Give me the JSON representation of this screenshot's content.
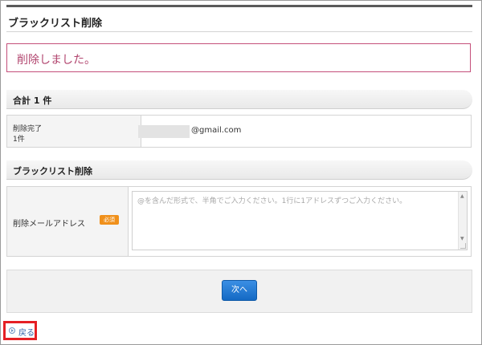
{
  "page": {
    "title": "ブラックリスト削除"
  },
  "alert": {
    "message": "削除しました。"
  },
  "summary": {
    "heading": "合計 1 件",
    "row_label_line1": "削除完了",
    "row_label_line2": "1件",
    "email_domain": "@gmail.com"
  },
  "form": {
    "heading": "ブラックリスト削除",
    "field_label": "削除メールアドレス",
    "required_badge": "必須",
    "textarea_placeholder": "@を含んだ形式で、半角でご入力ください。1行に1アドレスずつご入力ください。"
  },
  "actions": {
    "next_label": "次へ"
  },
  "footer": {
    "back_label": "戻る"
  },
  "colors": {
    "alert_border": "#c44f7a",
    "alert_text": "#b2466f",
    "primary_button": "#1469c4",
    "badge": "#f0901b",
    "highlight": "#e51f24"
  }
}
